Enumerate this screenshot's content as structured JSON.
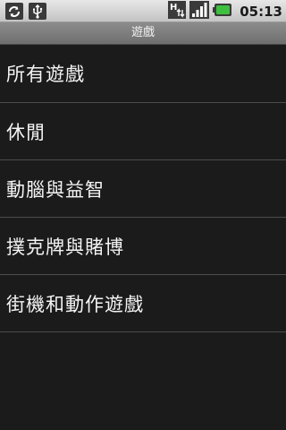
{
  "status_bar": {
    "icons_left": [
      "sync-icon",
      "usb-icon"
    ],
    "icons_right": [
      "data-transfer-icon",
      "signal-icon",
      "battery-icon"
    ],
    "time": "05:13",
    "accent_color": "#3fbf3f"
  },
  "title_bar": {
    "title": "遊戲"
  },
  "list": {
    "items": [
      {
        "label": "所有遊戲"
      },
      {
        "label": "休閒"
      },
      {
        "label": "動腦與益智"
      },
      {
        "label": "撲克牌與賭博"
      },
      {
        "label": "街機和動作遊戲"
      }
    ]
  }
}
